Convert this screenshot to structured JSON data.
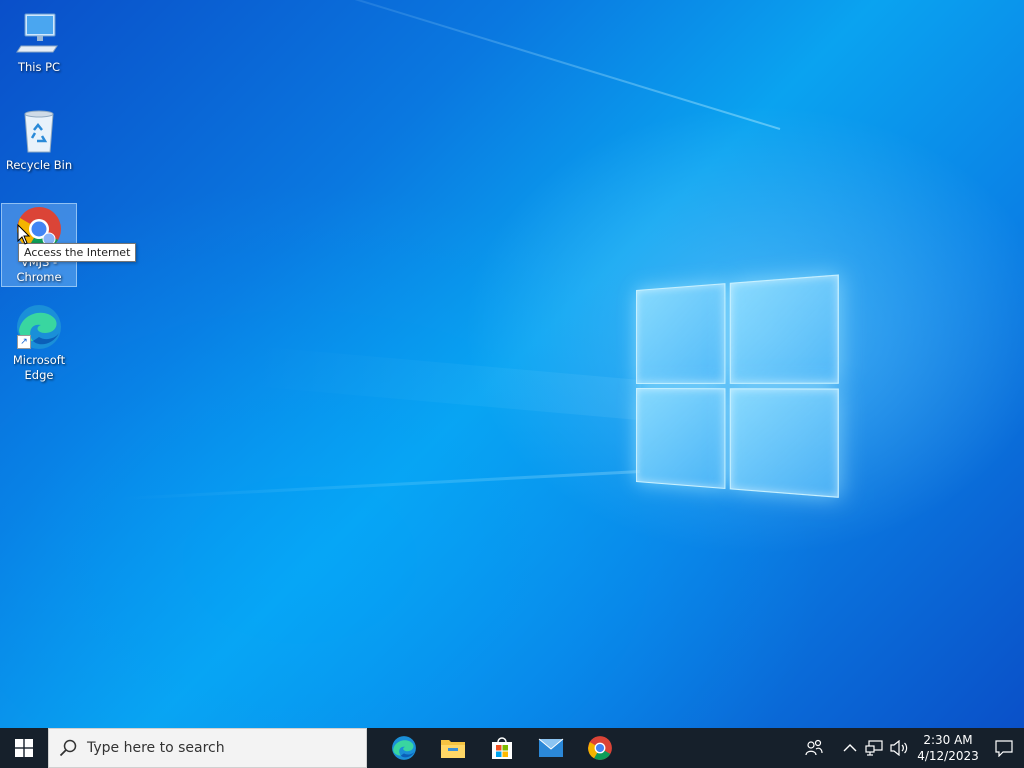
{
  "desktop": {
    "icons": [
      {
        "label": "This PC",
        "icon": "computer-icon"
      },
      {
        "label": "Recycle Bin",
        "icon": "recycle-bin-icon"
      },
      {
        "label": "VMJS - Chrome",
        "icon": "chrome-icon"
      },
      {
        "label": "Microsoft Edge",
        "icon": "edge-icon"
      }
    ],
    "tooltip": "Access the Internet"
  },
  "taskbar": {
    "search_placeholder": "Type here to search",
    "apps": [
      "edge-icon",
      "file-explorer-icon",
      "microsoft-store-icon",
      "mail-icon",
      "chrome-icon"
    ],
    "tray_icons": [
      "people-icon",
      "chevron-up-icon",
      "network-icon",
      "volume-icon"
    ],
    "clock": {
      "time": "2:30 AM",
      "date": "4/12/2023"
    },
    "notification_icon": "action-center-icon"
  },
  "colors": {
    "taskbar": "#16202b",
    "wallpaper_accent": "#0a78e0",
    "search_bg": "#f3f3f3"
  }
}
